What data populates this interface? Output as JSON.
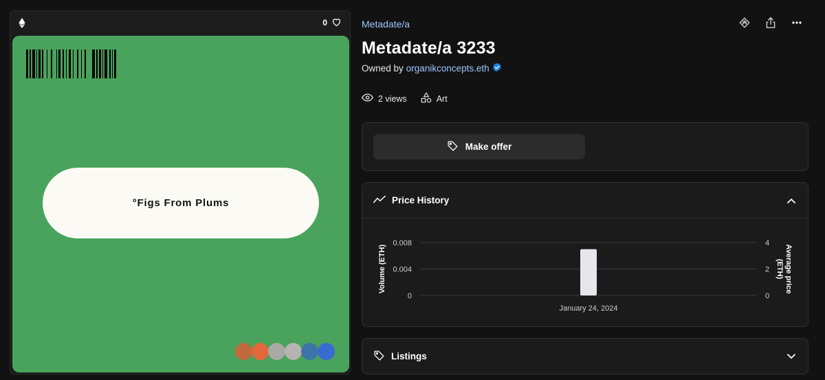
{
  "media": {
    "favorite_count": "0",
    "artwork_text": "°Figs From Plums",
    "swatches": [
      "#c06a3d",
      "#e4673b",
      "#a9aaa5",
      "#b6b3b0",
      "#3d74a8",
      "#3a6bd1"
    ]
  },
  "collection_name": "Metadate/a",
  "item_title": "Metadate/a 3233",
  "owner": {
    "prefix": "Owned by",
    "name": "organikconcepts.eth"
  },
  "stats": {
    "views": "2 views",
    "category": "Art"
  },
  "offer": {
    "button_label": "Make offer"
  },
  "price_history": {
    "title": "Price History",
    "chart_data": {
      "type": "bar",
      "categories": [
        "January 24, 2024"
      ],
      "series": [
        {
          "values": [
            0.007
          ]
        }
      ],
      "left_axis": {
        "label": "Volume (ETH)",
        "ticks": [
          "0",
          "0.004",
          "0.008"
        ],
        "range": [
          0,
          0.008
        ]
      },
      "right_axis": {
        "label": "Average price (ETH)",
        "ticks": [
          "0",
          "2",
          "4"
        ],
        "range": [
          0,
          4
        ]
      },
      "x_tick_labels": [
        "January 24, 2024"
      ],
      "bar_color": "#e6e6ec",
      "grid": true
    }
  },
  "listings": {
    "title": "Listings"
  },
  "colors": {
    "background": "#121212",
    "artwork_green": "#4aa35c",
    "link_blue": "#9ec5ff",
    "verified_badge": "#2081e2"
  }
}
